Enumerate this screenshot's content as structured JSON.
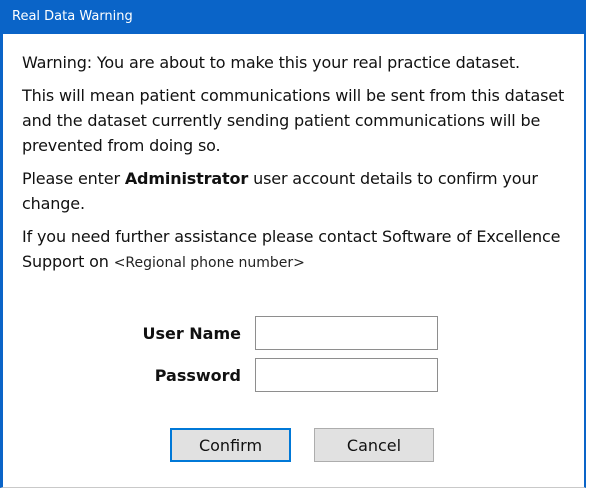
{
  "window": {
    "title": "Real Data Warning"
  },
  "message": {
    "warning": "Warning: You are about to make this your real practice dataset.",
    "consequence": "This will mean patient communications will be sent from this dataset and the dataset currently sending patient communications will be prevented from doing so.",
    "enter_prefix": "Please enter ",
    "enter_bold": "Administrator",
    "enter_suffix": " user account details to confirm your change.",
    "assist_text": "If you need further assistance please contact Software of Excellence Support on ",
    "phone_placeholder": "<Regional phone number>"
  },
  "form": {
    "username_label": "User Name",
    "username_value": "",
    "password_label": "Password",
    "password_value": ""
  },
  "buttons": {
    "confirm_label": "Confirm",
    "cancel_label": "Cancel"
  },
  "colors": {
    "titlebar": "#0a64c8",
    "default_button_border": "#0078d7"
  }
}
